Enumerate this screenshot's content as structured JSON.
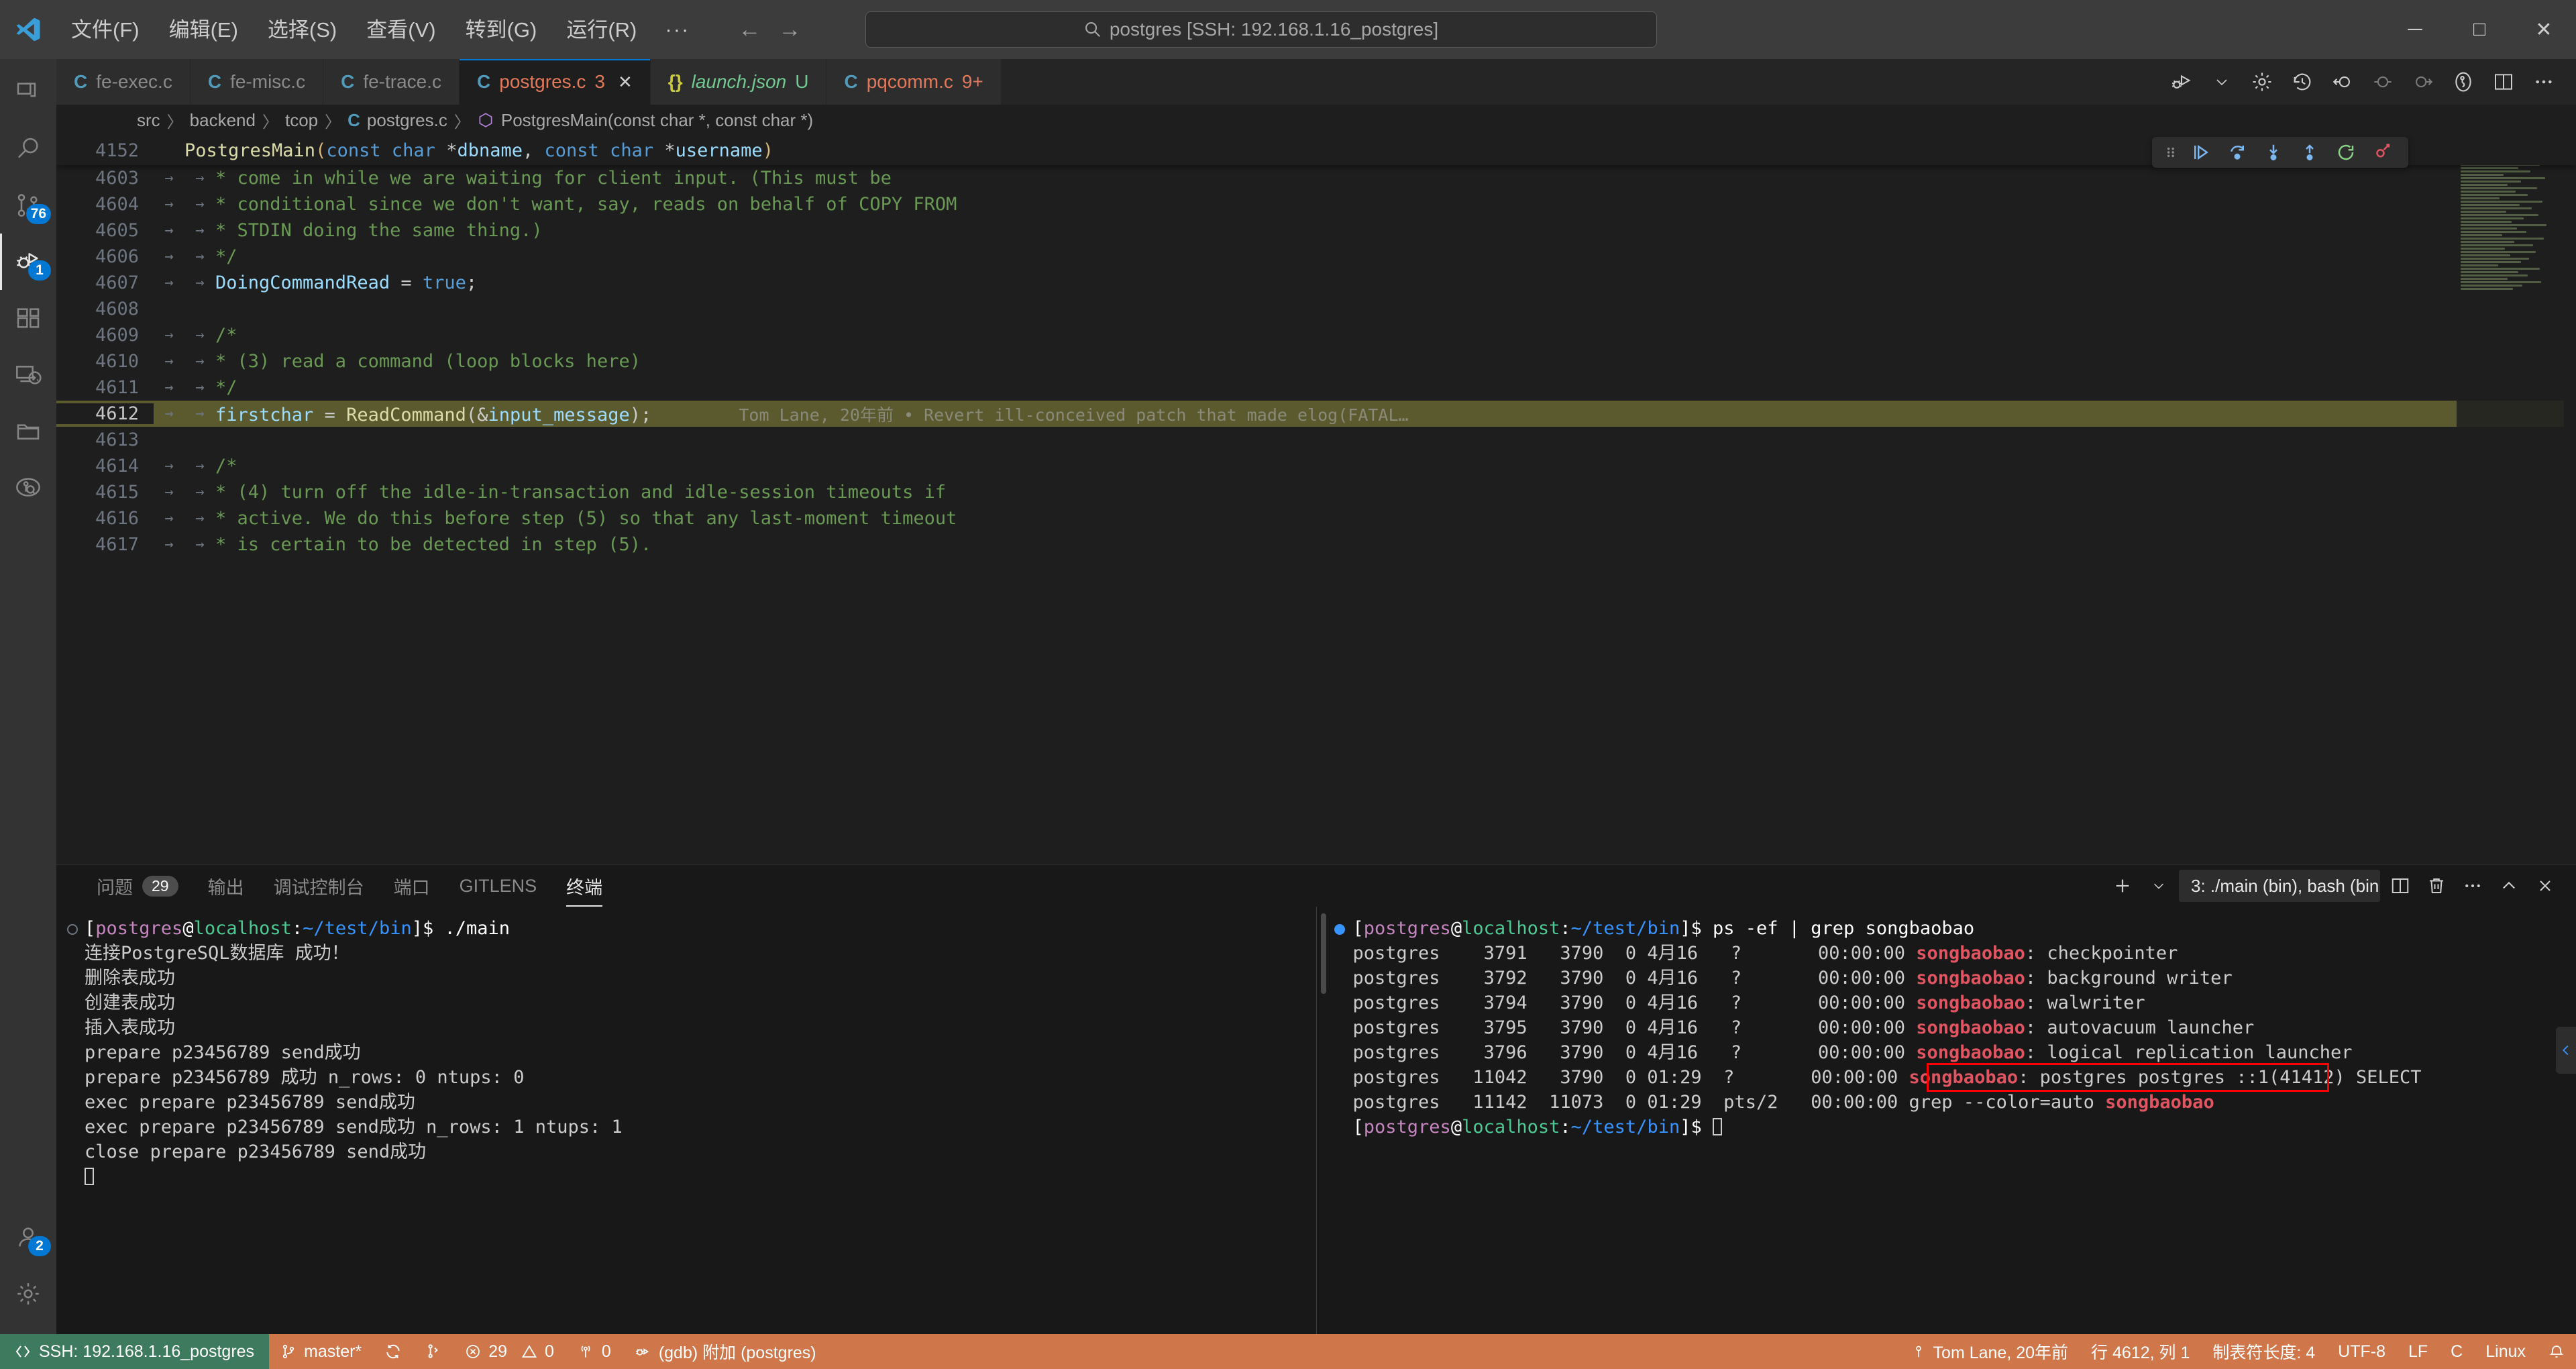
{
  "titlebar": {
    "menu_items": [
      "文件(F)",
      "编辑(E)",
      "选择(S)",
      "查看(V)",
      "转到(G)",
      "运行(R)"
    ],
    "more_label": "···",
    "search_text": "postgres [SSH: 192.168.1.16_postgres]",
    "back_glyph": "←",
    "forward_glyph": "→",
    "minimize": "─",
    "maximize": "□",
    "close": "✕"
  },
  "activitybar": {
    "items": [
      {
        "name": "explorer",
        "badge": ""
      },
      {
        "name": "search",
        "badge": ""
      },
      {
        "name": "source-control",
        "badge": "76"
      },
      {
        "name": "run-and-debug",
        "badge": "1"
      },
      {
        "name": "extensions",
        "badge": ""
      },
      {
        "name": "remote-explorer",
        "badge": ""
      },
      {
        "name": "folder",
        "badge": ""
      },
      {
        "name": "gitlens",
        "badge": ""
      },
      {
        "name": "timeline",
        "badge": ""
      }
    ],
    "bottom": [
      {
        "name": "accounts",
        "badge": "2"
      },
      {
        "name": "settings",
        "badge": ""
      }
    ]
  },
  "tabs": [
    {
      "icon": "C",
      "icon_class": "c",
      "label": "fe-exec.c",
      "badge": "",
      "active": false,
      "modified": false
    },
    {
      "icon": "C",
      "icon_class": "c",
      "label": "fe-misc.c",
      "badge": "",
      "active": false,
      "modified": false
    },
    {
      "icon": "C",
      "icon_class": "c",
      "label": "fe-trace.c",
      "badge": "",
      "active": false,
      "modified": false
    },
    {
      "icon": "C",
      "icon_class": "c",
      "label": "postgres.c",
      "badge": "3",
      "active": true,
      "modified": true
    },
    {
      "icon": "{}",
      "icon_class": "json",
      "label": "launch.json",
      "badge": "U",
      "active": false,
      "modified": true
    },
    {
      "icon": "C",
      "icon_class": "c",
      "label": "pqcomm.c",
      "badge": "9+",
      "active": false,
      "modified": true
    }
  ],
  "breadcrumb": {
    "parts": [
      "src",
      "backend",
      "tcop"
    ],
    "file": "postgres.c",
    "symbol": "PostgresMain(const char *, const char *)",
    "separator": "〉"
  },
  "editor": {
    "sticky_line_no": "4152",
    "sticky_code": "PostgresMain(const char *dbname, const char *username)",
    "lines": [
      {
        "no": "4603",
        "text": "* come in while we are waiting for client input. (This must be",
        "kind": "comment"
      },
      {
        "no": "4604",
        "text": "* conditional since we don't want, say, reads on behalf of COPY FROM",
        "kind": "comment"
      },
      {
        "no": "4605",
        "text": "* STDIN doing the same thing.)",
        "kind": "comment"
      },
      {
        "no": "4606",
        "text": "*/",
        "kind": "comment"
      },
      {
        "no": "4607",
        "text": "DoingCommandRead = true;",
        "kind": "stmt"
      },
      {
        "no": "4608",
        "text": "",
        "kind": "blank"
      },
      {
        "no": "4609",
        "text": "/*",
        "kind": "comment"
      },
      {
        "no": "4610",
        "text": "* (3) read a command (loop blocks here)",
        "kind": "comment"
      },
      {
        "no": "4611",
        "text": "*/",
        "kind": "comment"
      },
      {
        "no": "4612",
        "text": "firstchar = ReadCommand(&input_message);",
        "kind": "current"
      },
      {
        "no": "4613",
        "text": "",
        "kind": "blank"
      },
      {
        "no": "4614",
        "text": "/*",
        "kind": "comment"
      },
      {
        "no": "4615",
        "text": "* (4) turn off the idle-in-transaction and idle-session timeouts if",
        "kind": "comment"
      },
      {
        "no": "4616",
        "text": "* active. We do this before step (5) so that any last-moment timeout",
        "kind": "comment"
      },
      {
        "no": "4617",
        "text": "* is certain to be detected in step (5).",
        "kind": "comment"
      }
    ],
    "blame_inline": "Tom Lane, 20年前 • Revert ill-conceived patch that made elog(FATAL…",
    "debug_toolbar": [
      "drag-handle",
      "continue",
      "step-over",
      "step-into",
      "step-out",
      "restart",
      "disconnect"
    ],
    "toolbar": [
      "run-and-debug",
      "chevron-down",
      "settings-gear",
      "history",
      "previous-change",
      "commit",
      "next-change",
      "gitlens",
      "split-editor",
      "more-actions"
    ]
  },
  "panel": {
    "tabs": [
      {
        "label": "问题",
        "badge": "29",
        "active": false
      },
      {
        "label": "输出",
        "badge": "",
        "active": false
      },
      {
        "label": "调试控制台",
        "badge": "",
        "active": false
      },
      {
        "label": "端口",
        "badge": "",
        "active": false
      },
      {
        "label": "GITLENS",
        "badge": "",
        "active": false
      },
      {
        "label": "终端",
        "badge": "",
        "active": true
      }
    ],
    "new_terminal_label": "+",
    "terminal_select": "3: ./main (bin), bash (bin",
    "actions": [
      "split-terminal",
      "kill-terminal",
      "more-actions",
      "maximize-panel",
      "close-panel"
    ]
  },
  "terminal_left": {
    "prompt": {
      "open": "[",
      "user": "postgres",
      "at": "@",
      "host": "localhost",
      "colon": ":",
      "path": "~/test/bin",
      "close": "]$"
    },
    "command": " ./main",
    "output": [
      "连接PostgreSQL数据库 成功！",
      "删除表成功",
      "创建表成功",
      "插入表成功",
      "",
      "prepare p23456789 send成功",
      "prepare p23456789 成功 n_rows: 0 ntups: 0",
      "",
      "exec prepare p23456789 send成功",
      "exec prepare p23456789 send成功 n_rows: 1 ntups: 1",
      "",
      "close prepare p23456789 send成功"
    ]
  },
  "terminal_right": {
    "prompt": {
      "open": "[",
      "user": "postgres",
      "at": "@",
      "host": "localhost",
      "colon": ":",
      "path": "~/test/bin",
      "close": "]$"
    },
    "command": " ps -ef | grep songbaobao",
    "match_word": "songbaobao",
    "rows": [
      {
        "user": "postgres",
        "pid": "3791",
        "ppid": "3790",
        "c": "0",
        "stime": "4月16",
        "tty": "?",
        "time": "00:00:00",
        "cmd_suffix": ": checkpointer",
        "boxed": false
      },
      {
        "user": "postgres",
        "pid": "3792",
        "ppid": "3790",
        "c": "0",
        "stime": "4月16",
        "tty": "?",
        "time": "00:00:00",
        "cmd_suffix": ": background writer",
        "boxed": false
      },
      {
        "user": "postgres",
        "pid": "3794",
        "ppid": "3790",
        "c": "0",
        "stime": "4月16",
        "tty": "?",
        "time": "00:00:00",
        "cmd_suffix": ": walwriter",
        "boxed": false
      },
      {
        "user": "postgres",
        "pid": "3795",
        "ppid": "3790",
        "c": "0",
        "stime": "4月16",
        "tty": "?",
        "time": "00:00:00",
        "cmd_suffix": ": autovacuum launcher",
        "boxed": false
      },
      {
        "user": "postgres",
        "pid": "3796",
        "ppid": "3790",
        "c": "0",
        "stime": "4月16",
        "tty": "?",
        "time": "00:00:00",
        "cmd_suffix": ": logical replication launcher",
        "boxed": false
      },
      {
        "user": "postgres",
        "pid": "11042",
        "ppid": "3790",
        "c": "0",
        "stime": "01:29",
        "tty": "?",
        "time": "00:00:00",
        "cmd_suffix": ": postgres postgres ::1(41412) SELECT",
        "boxed": true
      },
      {
        "user": "postgres",
        "pid": "11142",
        "ppid": "11073",
        "c": "0",
        "stime": "01:29",
        "tty": "pts/2",
        "time": "00:00:00",
        "cmd_prefix": "grep --color=auto ",
        "cmd_suffix": "",
        "boxed": false,
        "is_grep": true
      }
    ],
    "trailing_prompt": true
  },
  "statusbar": {
    "remote": "SSH: 192.168.1.16_postgres",
    "branch": "master*",
    "sync": "⟳",
    "errors": "29",
    "warnings": "0",
    "ports": "0",
    "debug_session": "(gdb) 附加 (postgres)",
    "blame": "Tom Lane, 20年前",
    "position": "行 4612, 列 1",
    "tabsize": "制表符长度: 4",
    "encoding": "UTF-8",
    "eol": "LF",
    "language": "C",
    "platform": "Linux",
    "bell": "🔔"
  },
  "colors": {
    "accent": "#0078d4",
    "remote_green": "#3e7a5e",
    "debug_orange": "#cf764b",
    "annotation_red": "#ff0000",
    "grep_red": "#e05561",
    "highlight_line": "#5a5a2e"
  }
}
